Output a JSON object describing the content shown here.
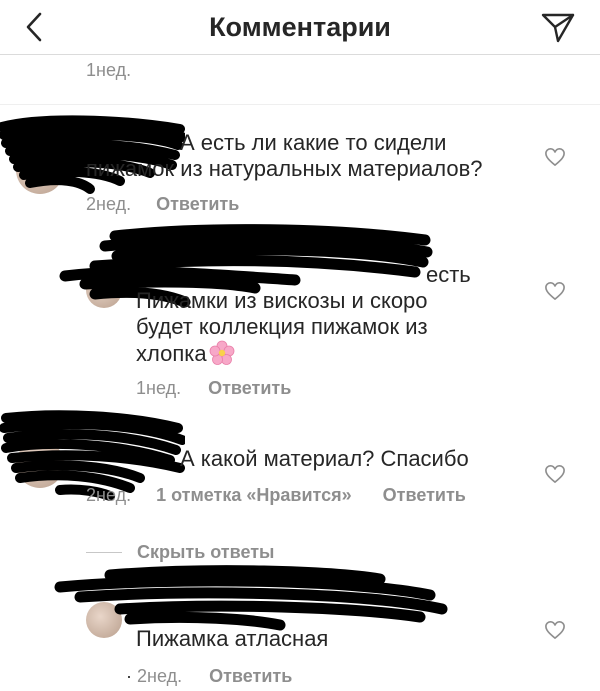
{
  "header": {
    "title": "Комментарии"
  },
  "top_meta": {
    "time": "1нед."
  },
  "comments": [
    {
      "text": "А есть ли какие то сидели пижамок из натуральных материалов?",
      "line1": "А есть ли какие то сидели",
      "line2": "пижамок из натуральных материалов?",
      "time": "2нед.",
      "reply_label": "Ответить"
    },
    {
      "text": "есть Пижамки из вискозы и скоро будет коллекция пижамок из хлопка",
      "line1": "есть",
      "line2": "Пижамки из вискозы и скоро",
      "line3": "будет коллекция пижамок из",
      "line4": "хлопка",
      "emoji_name": "cherry-blossom-icon",
      "time": "1нед.",
      "reply_label": "Ответить"
    },
    {
      "text": "А какой материал? Спасибо",
      "time": "2нед.",
      "likes": "1 отметка «Нравится»",
      "reply_label": "Ответить"
    },
    {
      "text": "Пижамка атласная",
      "time": "2нед.",
      "reply_label": "Ответить"
    }
  ],
  "hide_replies": {
    "label": "Скрыть ответы"
  },
  "colors": {
    "text": "#262626",
    "secondary": "#8e8e8e",
    "divider": "#dbdbdb"
  }
}
